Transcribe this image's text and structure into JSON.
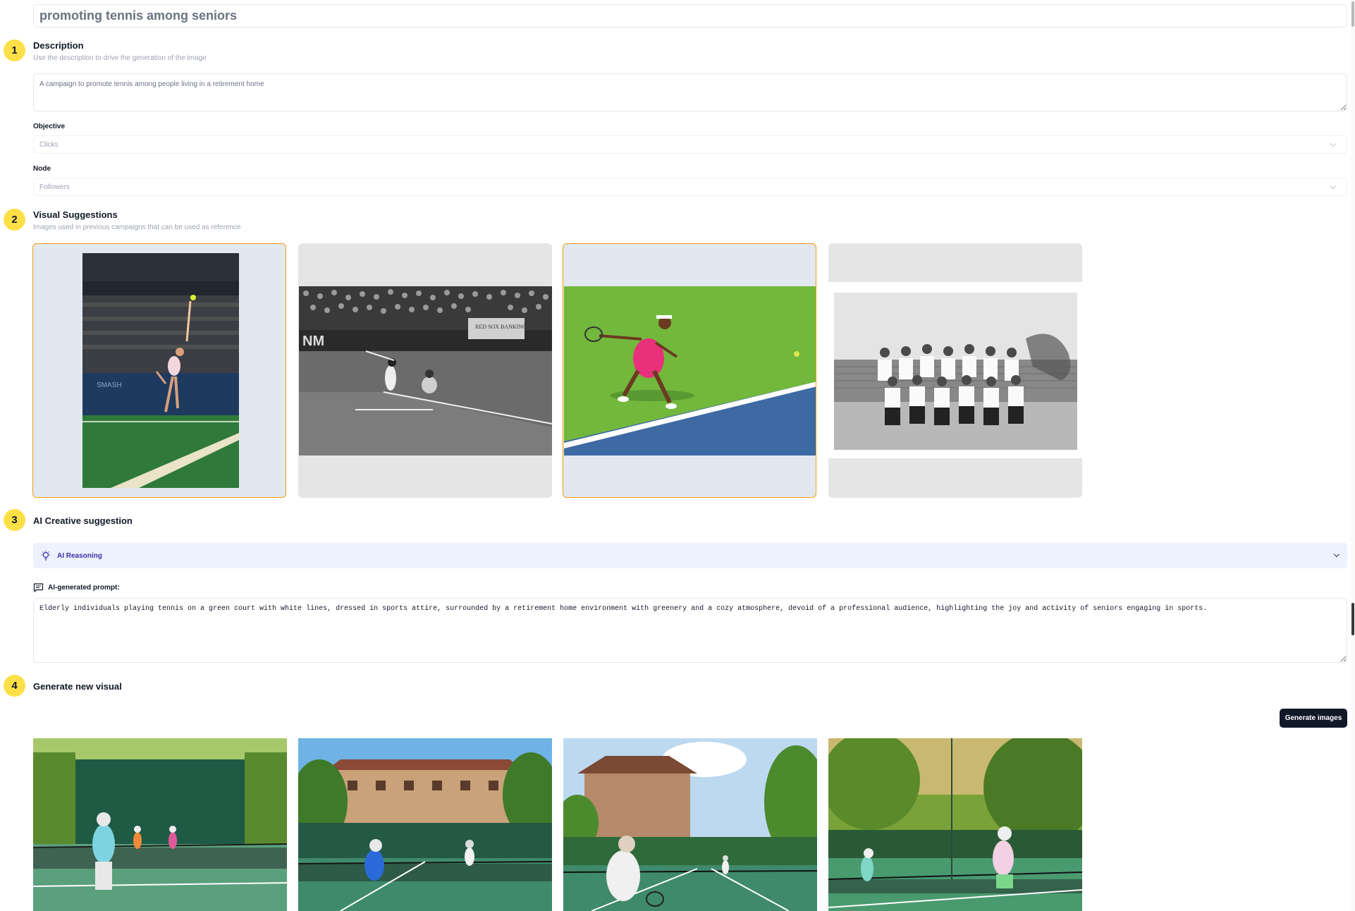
{
  "header": {
    "title": "promoting tennis among seniors"
  },
  "steps": [
    {
      "number": "1",
      "title": "Description",
      "subtitle": "Use the description to drive the generation of the image"
    },
    {
      "number": "2",
      "title": "Visual Suggestions",
      "subtitle": "Images used in previous campaigns that can be used as reference"
    },
    {
      "number": "3",
      "title": "AI Creative suggestion"
    },
    {
      "number": "4",
      "title": "Generate new visual"
    }
  ],
  "description": {
    "value": "A campaign to promote tennis among people living in a retirement home"
  },
  "objective": {
    "label": "Objective",
    "value": "Clicks"
  },
  "node": {
    "label": "Node",
    "value": "Followers"
  },
  "visual_suggestions": [
    {
      "name": "tennis-player-serving",
      "selected": true
    },
    {
      "name": "baseball-batter-bw",
      "selected": false
    },
    {
      "name": "tennis-player-pink-outfit",
      "selected": true
    },
    {
      "name": "womens-tennis-team-bw",
      "selected": false
    }
  ],
  "ai_reasoning": {
    "label": "AI Reasoning",
    "icon": "lightbulb-icon"
  },
  "ai_prompt": {
    "label": "AI-generated prompt:",
    "icon": "message-square-icon",
    "value": "Elderly individuals playing tennis on a green court with white lines, dressed in sports attire, surrounded by a retirement home environment with greenery and a cozy atmosphere, devoid of a professional audience, highlighting the joy and activity of seniors engaging in sports."
  },
  "generate": {
    "button_label": "Generate images"
  },
  "generated_images": [
    {
      "name": "seniors-tennis-hedge-court"
    },
    {
      "name": "seniors-tennis-residence-court"
    },
    {
      "name": "seniors-tennis-villa-court"
    },
    {
      "name": "seniors-tennis-garden-court"
    }
  ],
  "colors": {
    "accent": "#fde047",
    "selected_border": "#f59e0b",
    "button": "#111827",
    "reasoning_bg": "#eef2ff"
  }
}
